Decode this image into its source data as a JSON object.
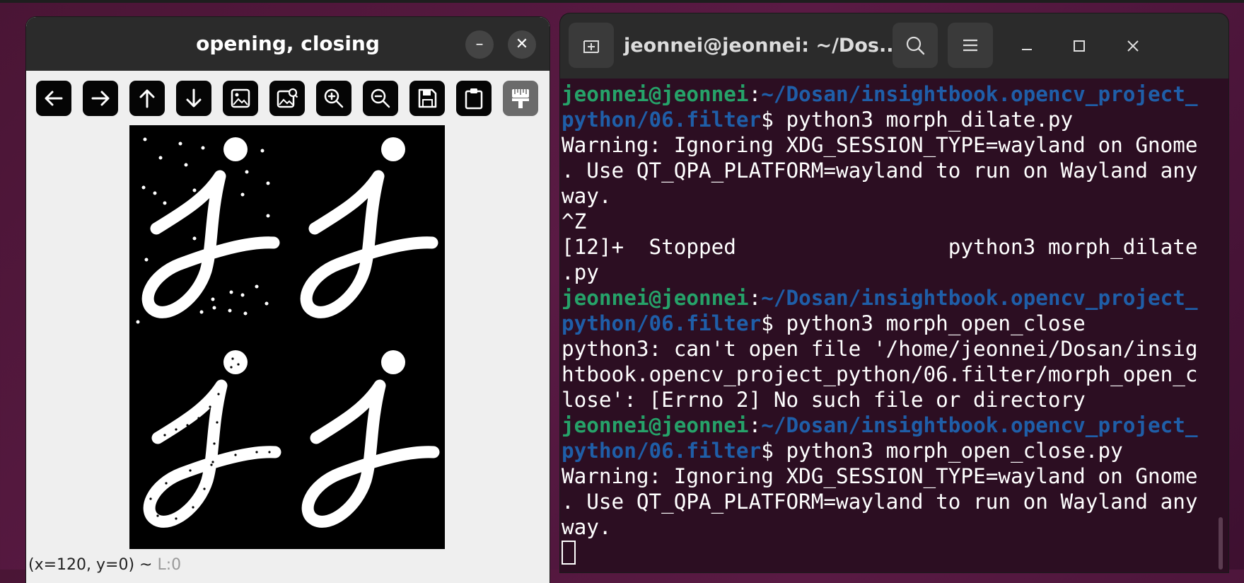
{
  "cv_window": {
    "title": "opening, closing",
    "minimize_glyph": "–",
    "close_glyph": "✕",
    "toolbar": [
      {
        "name": "pan-left-button",
        "icon": "arrow-left-icon"
      },
      {
        "name": "pan-right-button",
        "icon": "arrow-right-icon"
      },
      {
        "name": "pan-up-button",
        "icon": "arrow-up-icon"
      },
      {
        "name": "pan-down-button",
        "icon": "arrow-down-icon"
      },
      {
        "name": "zoom-original-button",
        "icon": "image-icon"
      },
      {
        "name": "zoom-fit-button",
        "icon": "image-fit-icon"
      },
      {
        "name": "zoom-in-button",
        "icon": "zoom-in-icon"
      },
      {
        "name": "zoom-out-button",
        "icon": "zoom-out-icon"
      },
      {
        "name": "save-image-button",
        "icon": "save-icon"
      },
      {
        "name": "copy-clipboard-button",
        "icon": "clipboard-icon"
      },
      {
        "name": "properties-button",
        "icon": "paint-brush-icon"
      }
    ],
    "status_coords": "(x=120, y=0) ~",
    "status_value": "L:0"
  },
  "terminal": {
    "title": "jeonnei@jeonnei: ~/Dos...",
    "prompt_user": "jeonnei@jeonnei",
    "lines": [
      {
        "user": "jeonnei@jeonnei",
        "sep": ":",
        "path": "~/Dosan/insightbook.opencv_project_",
        "text": ""
      },
      {
        "user": "",
        "sep": "",
        "path": "python/06.filter",
        "text": "$ python3 morph_dilate.py"
      },
      {
        "user": "",
        "sep": "",
        "path": "",
        "text": "Warning: Ignoring XDG_SESSION_TYPE=wayland on Gnome"
      },
      {
        "user": "",
        "sep": "",
        "path": "",
        "text": ". Use QT_QPA_PLATFORM=wayland to run on Wayland any"
      },
      {
        "user": "",
        "sep": "",
        "path": "",
        "text": "way."
      },
      {
        "user": "",
        "sep": "",
        "path": "",
        "text": "^Z"
      },
      {
        "user": "",
        "sep": "",
        "path": "",
        "text": "[12]+  Stopped                 python3 morph_dilate"
      },
      {
        "user": "",
        "sep": "",
        "path": "",
        "text": ".py"
      },
      {
        "user": "jeonnei@jeonnei",
        "sep": ":",
        "path": "~/Dosan/insightbook.opencv_project_",
        "text": ""
      },
      {
        "user": "",
        "sep": "",
        "path": "python/06.filter",
        "text": "$ python3 morph_open_close"
      },
      {
        "user": "",
        "sep": "",
        "path": "",
        "text": "python3: can't open file '/home/jeonnei/Dosan/insig"
      },
      {
        "user": "",
        "sep": "",
        "path": "",
        "text": "htbook.opencv_project_python/06.filter/morph_open_c"
      },
      {
        "user": "",
        "sep": "",
        "path": "",
        "text": "lose': [Errno 2] No such file or directory"
      },
      {
        "user": "jeonnei@jeonnei",
        "sep": ":",
        "path": "~/Dosan/insightbook.opencv_project_",
        "text": ""
      },
      {
        "user": "",
        "sep": "",
        "path": "python/06.filter",
        "text": "$ python3 morph_open_close.py"
      },
      {
        "user": "",
        "sep": "",
        "path": "",
        "text": "Warning: Ignoring XDG_SESSION_TYPE=wayland on Gnome"
      },
      {
        "user": "",
        "sep": "",
        "path": "",
        "text": ". Use QT_QPA_PLATFORM=wayland to run on Wayland any"
      },
      {
        "user": "",
        "sep": "",
        "path": "",
        "text": "way."
      }
    ]
  },
  "colors": {
    "desktop": "#4a1535",
    "terminal_bg": "#2c0e22",
    "prompt_user": "#26a269",
    "prompt_path": "#1f5ea8"
  }
}
